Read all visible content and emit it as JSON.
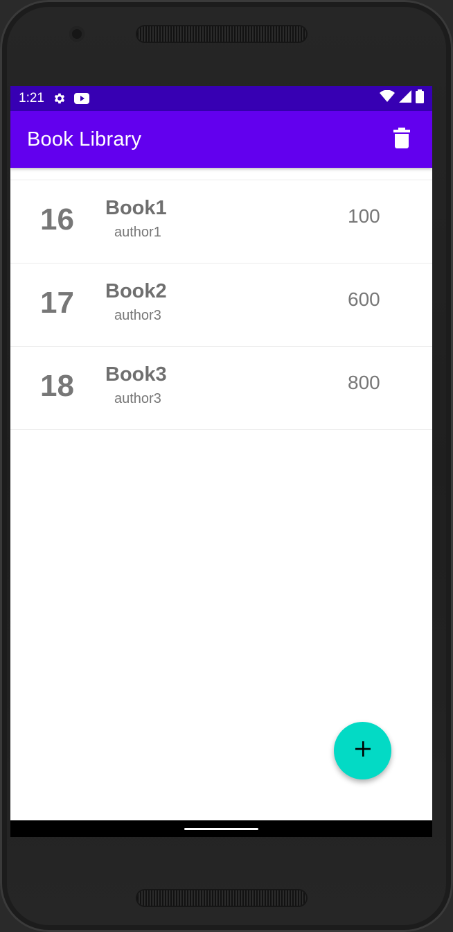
{
  "status_bar": {
    "time": "1:21",
    "left_icons": [
      "gear-icon",
      "youtube-icon"
    ],
    "right_icons": [
      "wifi-icon",
      "signal-icon",
      "battery-icon"
    ],
    "background": "#3700b3"
  },
  "app_bar": {
    "title": "Book Library",
    "action_icon": "trash-icon",
    "background": "#6200ee"
  },
  "books": [
    {
      "id": "16",
      "title": "Book1",
      "author": "author1",
      "price": "100"
    },
    {
      "id": "17",
      "title": "Book2",
      "author": "author3",
      "price": "600"
    },
    {
      "id": "18",
      "title": "Book3",
      "author": "author3",
      "price": "800"
    }
  ],
  "fab": {
    "icon": "plus-icon",
    "background": "#03dac5"
  }
}
